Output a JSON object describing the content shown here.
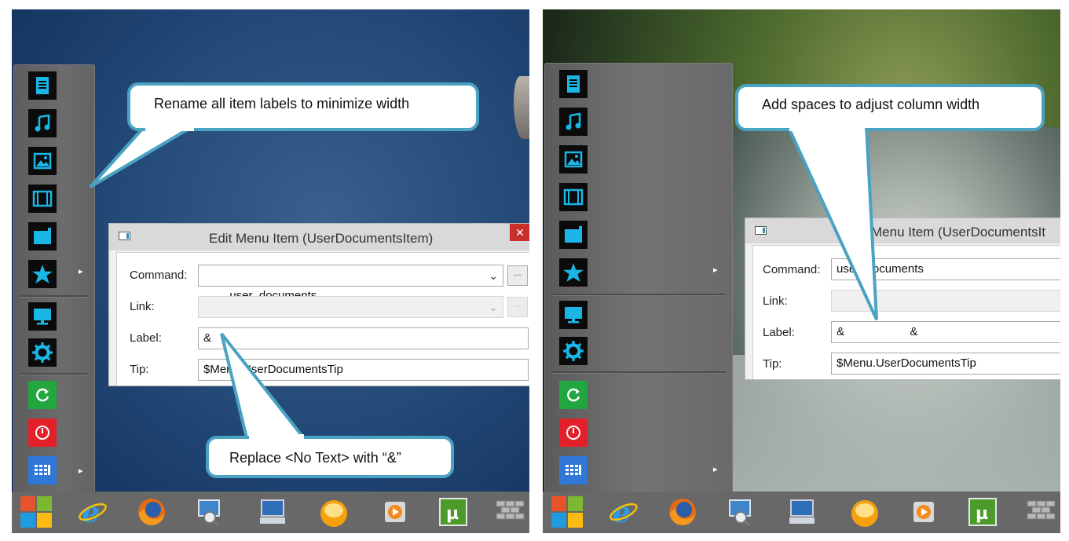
{
  "left_panel": {
    "dialog": {
      "title": "Edit Menu Item (UserDocumentsItem)",
      "close_glyph": "✕",
      "command_label": "Command:",
      "command_value": "user_documents",
      "link_label": "Link:",
      "link_value": "",
      "label_label": "Label:",
      "label_value": "&",
      "tip_label": "Tip:",
      "tip_value": "$Menu.UserDocumentsTip",
      "browse_button": "...",
      "chevron": "⌄"
    },
    "callout_top": "Rename all item labels to minimize width",
    "callout_bottom": "Replace  <No Text> with “&”"
  },
  "right_panel": {
    "dialog": {
      "title": "Menu Item (UserDocumentsIt",
      "command_label": "Command:",
      "command_value": "user_documents",
      "link_label": "Link:",
      "link_value": "",
      "label_label": "Label:",
      "label_value": "&                    &",
      "tip_label": "Tip:",
      "tip_value": "$Menu.UserDocumentsTip"
    },
    "callout_top": "Add spaces to adjust column width"
  },
  "start_menu_icons": [
    "documents-icon",
    "music-icon",
    "pictures-icon",
    "videos-icon",
    "user-files-icon",
    "favorites-icon",
    "computer-icon",
    "settings-icon",
    "restart-icon",
    "power-icon",
    "apps-icon"
  ],
  "arrow_glyph": "▸",
  "taskbar_icons": [
    "windows-logo-icon",
    "internet-explorer-icon",
    "firefox-icon",
    "search-explorer-icon",
    "remote-desktop-icon",
    "media-player-classic-icon",
    "media-icon",
    "utorrent-icon",
    "wall-icon"
  ],
  "colors": {
    "callout_border": "#4aa3c2",
    "icon_accent": "#19b6e6",
    "close_button": "#c7302a"
  }
}
